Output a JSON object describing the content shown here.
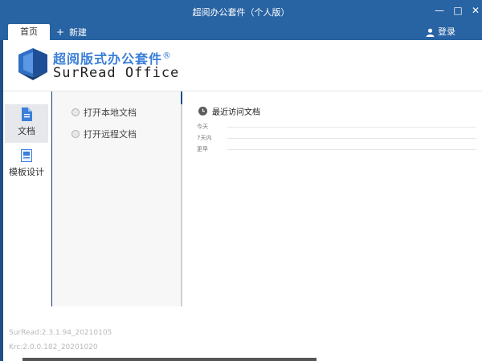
{
  "window": {
    "title": "超阅办公套件（个人版）",
    "min_glyph": "—",
    "max_glyph": "□",
    "close_glyph": "✕"
  },
  "tabs": {
    "home_label": "首页",
    "new_label": "新建",
    "new_icon": "plus-icon"
  },
  "user": {
    "login_label": "登录",
    "icon": "user-icon"
  },
  "brand": {
    "name_cn": "超阅版式办公套件",
    "registered": "®",
    "name_en": "SurRead Office"
  },
  "rail": {
    "items": [
      {
        "label": "文档",
        "icon": "document-icon",
        "active": true
      },
      {
        "label": "模板设计",
        "icon": "template-icon",
        "active": false
      }
    ]
  },
  "actions": {
    "open_local": "打开本地文档",
    "open_remote": "打开远程文档"
  },
  "recent": {
    "title": "最近访问文档",
    "groups": [
      "今天",
      "7天内",
      "更早"
    ]
  },
  "versions": {
    "surread": "SurRead:2.3.1.94_20210105",
    "krc": "Krc:2.0.0.182_20201020"
  },
  "colors": {
    "titlebar": "#2863a3",
    "brand_blue": "#3a7fd8"
  }
}
